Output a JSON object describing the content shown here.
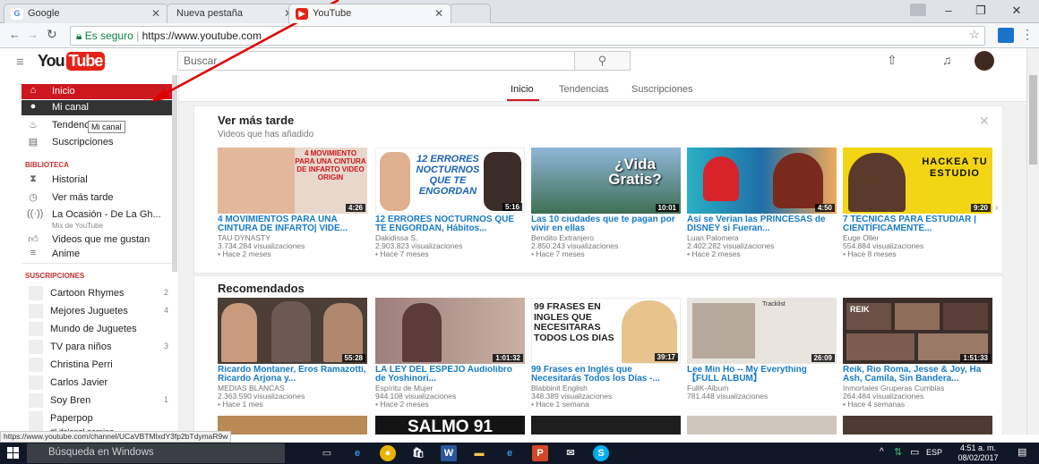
{
  "browser": {
    "tabs": [
      {
        "label": "Google",
        "icon": "google-favicon",
        "color": "#4285f4"
      },
      {
        "label": "Nueva pestaña",
        "icon": "blank-page-icon"
      },
      {
        "label": "YouTube",
        "icon": "youtube-favicon",
        "color": "#e62117"
      }
    ],
    "secure_label": "Es seguro",
    "url": "https://www.youtube.com"
  },
  "masthead": {
    "logo_you": "You",
    "logo_tube": "Tube",
    "search_placeholder": "Buscar"
  },
  "sidebar": {
    "nav": [
      {
        "label": "Inicio",
        "icon": "home-icon"
      },
      {
        "label": "Mi canal",
        "icon": "account-icon"
      },
      {
        "label": "Tendencias",
        "icon": "trending-icon"
      },
      {
        "label": "Suscripciones",
        "icon": "subscriptions-icon"
      }
    ],
    "tooltip": "Mi canal",
    "library_header": "BIBLIOTECA",
    "library": [
      {
        "label": "Historial",
        "icon": "hourglass-icon"
      },
      {
        "label": "Ver más tarde",
        "icon": "clock-icon"
      },
      {
        "label": "La Ocasión - De La Gh...",
        "sublabel": "Mix de YouTube",
        "icon": "mix-icon"
      },
      {
        "label": "Videos que me gustan",
        "icon": "thumbs-up-icon"
      },
      {
        "label": "Anime",
        "icon": "playlist-icon"
      }
    ],
    "subs_header": "SUSCRIPCIONES",
    "subscriptions": [
      {
        "label": "Cartoon Rhymes",
        "count": "2"
      },
      {
        "label": "Mejores Juguetes",
        "count": "4"
      },
      {
        "label": "Mundo de Juguetes",
        "count": ""
      },
      {
        "label": "TV para niños",
        "count": "3"
      },
      {
        "label": "Christina Perri",
        "count": ""
      },
      {
        "label": "Carlos Javier",
        "count": ""
      },
      {
        "label": "Soy Bren",
        "count": "1"
      },
      {
        "label": "Paperpop",
        "count": ""
      },
      {
        "label": "#Lifelongl earning",
        "count": ""
      }
    ]
  },
  "main": {
    "tabs": [
      "Inicio",
      "Tendencias",
      "Suscripciones"
    ],
    "watch_later": {
      "title": "Ver más tarde",
      "subtitle": "Videos que has añadido",
      "videos": [
        {
          "title": "4 MOVIMIENTOS PARA UNA CINTURA DE INFARTO| VIDE...",
          "channel": "TAU DYNASTY",
          "views": "3.734.284 visualizaciones",
          "age": "• Hace 2 meses",
          "duration": "4:26",
          "thumb_text": "4 MOVIMIENTO PARA UNA CINTURA DE INFARTO VIDEO ORIGIN",
          "thumb_bg": "#e8d8cc"
        },
        {
          "title": "12 ERRORES NOCTURNOS QUE TE ENGORDAN, Hábitos...",
          "channel": "Dakidissa S.",
          "views": "2.903.823 visualizaciones",
          "age": "• Hace 7 meses",
          "duration": "5:16",
          "thumb_text": "12 ERRORES NOCTURNOS QUE TE ENGORDAN",
          "thumb_bg": "#ffffff"
        },
        {
          "title": "Las 10 ciudades que te pagan por vivir en ellas",
          "channel": "Bendito Extranjero",
          "views": "2.850.243 visualizaciones",
          "age": "• Hace 7 meses",
          "duration": "10:01",
          "thumb_text": "¿Vida Gratis?",
          "thumb_bg": "#5b8fb5"
        },
        {
          "title": "Así se Verían las PRINCESAS de DISNEY si Fueran...",
          "channel": "Luan Palomera",
          "views": "2.402.282 visualizaciones",
          "age": "• Hace 2 meses",
          "duration": "4:50",
          "thumb_text": "",
          "thumb_bg": "#2a9ab0"
        },
        {
          "title": "7 TÉCNICAS PARA ESTUDIAR | CIENTÍFICAMENTE...",
          "channel": "Euge Oller",
          "views": "554.884 visualizaciones",
          "age": "• Hace 8 meses",
          "duration": "9:20",
          "thumb_text": "HACKEA TU ESTUDIO",
          "thumb_bg": "#f2d515"
        }
      ]
    },
    "recommended": {
      "title": "Recomendados",
      "videos": [
        {
          "title": "Ricardo Montaner, Eros Ramazotti, Ricardo Arjona y...",
          "channel": "MEDIAS BLANCAS",
          "views": "2.363.590 visualizaciones",
          "age": "• Hace 1 mes",
          "duration": "55:28",
          "thumb_text": "",
          "thumb_bg": "#4a3e36"
        },
        {
          "title": "LA LEY DEL ESPEJO Audiolibro de Yoshinori...",
          "channel": "Espíritu de Mujer",
          "views": "944.108 visualizaciones",
          "age": "• Hace 2 meses",
          "duration": "1:01:32",
          "thumb_text": "",
          "thumb_bg": "#8a6a6e"
        },
        {
          "title": "99 Frases en Inglés que Necesitarás Todos los Días -...",
          "channel": "Blabbinit English",
          "views": "348.389 visualizaciones",
          "age": "• Hace 1 semana",
          "duration": "39:17",
          "thumb_text": "99 FRASES EN INGLES QUE NECESITARAS TODOS LOS DIAS",
          "thumb_bg": "#ffffff"
        },
        {
          "title": "Lee Min Ho -- My Everything【FULL ALBUM】",
          "channel": "FullK-Album",
          "views": "781.448 visualizaciones",
          "age": "• Hace 3 años",
          "duration": "26:09",
          "thumb_text": "Tracklist",
          "thumb_bg": "#e8e4de"
        },
        {
          "title": "Reik, Rio Roma, Jesse & Joy, Ha Ash, Camila, Sin Bandera...",
          "channel": "Inmortales Gruperas Cumbias",
          "views": "264.484 visualizaciones",
          "age": "• Hace 4 semanas",
          "duration": "1:51:33",
          "thumb_text": "REIK",
          "thumb_bg": "#3a2e2a"
        }
      ]
    },
    "next_row_thumb_text": "SALMO 91"
  },
  "status_url": "https://www.youtube.com/channel/UCaVBTMlxdY3fp2bTdymaR9w",
  "taskbar": {
    "search_placeholder": "Búsqueda en Windows",
    "language": "ESP",
    "time": "4:51 a. m.",
    "date": "08/02/2017"
  }
}
